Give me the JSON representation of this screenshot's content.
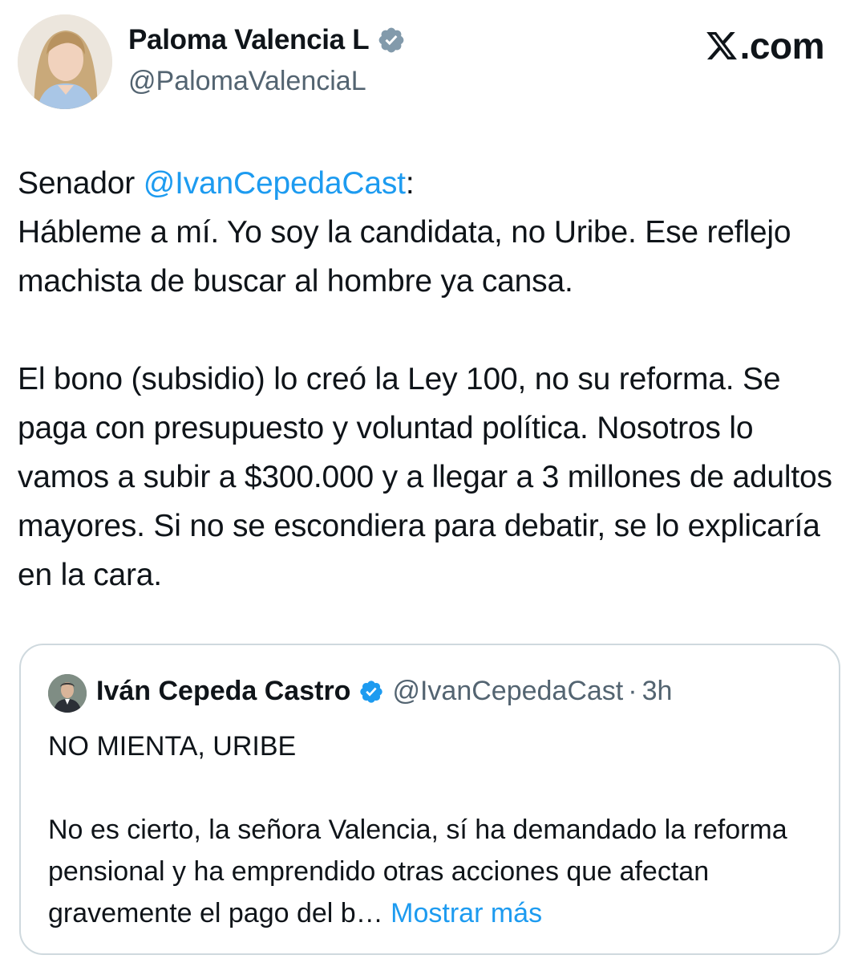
{
  "author": {
    "display_name": "Paloma Valencia L",
    "handle": "@PalomaValenciaL",
    "verified_icon": "verified-badge-icon"
  },
  "site_logo": {
    "icon": "x-logo-icon",
    "text": ".com"
  },
  "tweet": {
    "line1_prefix": "Senador ",
    "line1_mention": "@IvanCepedaCast",
    "line1_suffix": ":",
    "paragraph1": "Hábleme a mí. Yo soy la candidata, no Uribe. Ese reflejo machista de buscar al hombre ya cansa.",
    "paragraph2": "El bono (subsidio) lo creó la Ley 100, no su reforma. Se paga con presupuesto y voluntad política. Nosotros lo vamos a subir a $300.000 y a llegar a 3 millones de adultos mayores. Si no se escondiera para debatir, se lo explicaría en la cara."
  },
  "quoted_tweet": {
    "display_name": "Iván Cepeda Castro",
    "handle": "@IvanCepedaCast",
    "separator": "·",
    "time": "3h",
    "text_line1": "NO MIENTA, URIBE",
    "text_body": "No es cierto, la señora Valencia, sí ha demandado la reforma pensional y ha emprendido otras acciones que afectan gravemente el pago del b…",
    "show_more": "Mostrar más"
  },
  "colors": {
    "link_blue": "#1d9bf0",
    "secondary_text": "#536471",
    "border": "#cfd9de"
  }
}
